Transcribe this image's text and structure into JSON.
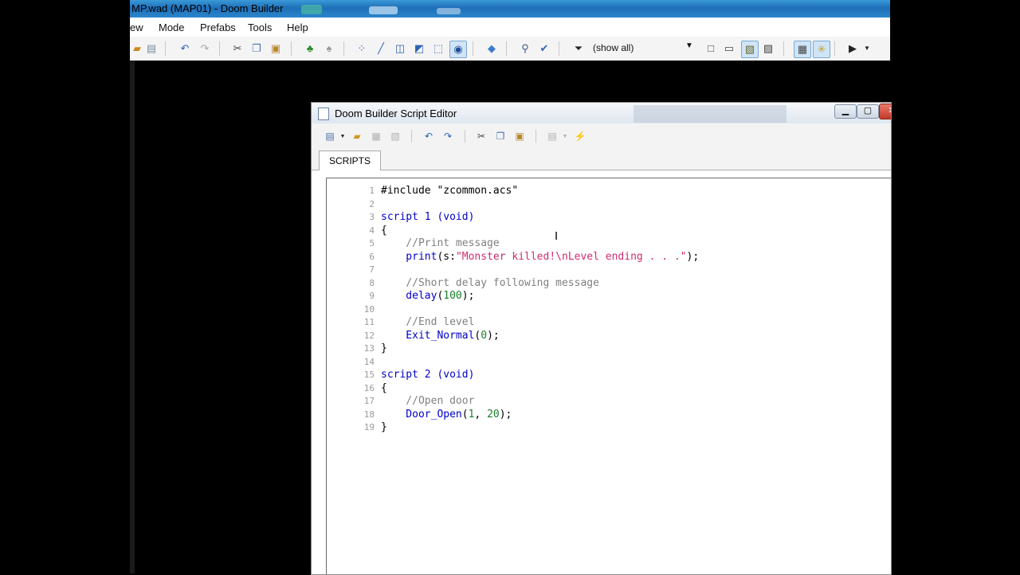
{
  "main_window": {
    "title": "MP.wad (MAP01) - Doom Builder",
    "menu": [
      "ew",
      "Mode",
      "Prefabs",
      "Tools",
      "Help"
    ],
    "filter": {
      "value": "(show all)"
    }
  },
  "script_editor": {
    "title": "Doom Builder Script Editor",
    "tabs": [
      {
        "label": "SCRIPTS"
      }
    ],
    "lines": [
      {
        "n": "1",
        "tokens": [
          {
            "t": "#include \"zcommon.acs\"",
            "c": "pl"
          }
        ]
      },
      {
        "n": "2",
        "tokens": []
      },
      {
        "n": "3",
        "tokens": [
          {
            "t": "script 1 (void)",
            "c": "kw"
          }
        ]
      },
      {
        "n": "4",
        "tokens": [
          {
            "t": "{",
            "c": "pl"
          }
        ]
      },
      {
        "n": "5",
        "tokens": [
          {
            "t": "    //Print message",
            "c": "cm"
          }
        ]
      },
      {
        "n": "6",
        "tokens": [
          {
            "t": "    print",
            "c": "kw"
          },
          {
            "t": "(s:",
            "c": "pl"
          },
          {
            "t": "\"Monster killed!\\nLevel ending . . .\"",
            "c": "st-lit"
          },
          {
            "t": ");",
            "c": "pl"
          }
        ]
      },
      {
        "n": "7",
        "tokens": []
      },
      {
        "n": "8",
        "tokens": [
          {
            "t": "    //Short delay following message",
            "c": "cm"
          }
        ]
      },
      {
        "n": "9",
        "tokens": [
          {
            "t": "    delay",
            "c": "kw"
          },
          {
            "t": "(",
            "c": "pl"
          },
          {
            "t": "100",
            "c": "num"
          },
          {
            "t": ");",
            "c": "pl"
          }
        ]
      },
      {
        "n": "10",
        "tokens": []
      },
      {
        "n": "11",
        "tokens": [
          {
            "t": "    //End level",
            "c": "cm"
          }
        ]
      },
      {
        "n": "12",
        "tokens": [
          {
            "t": "    Exit_Normal",
            "c": "kw"
          },
          {
            "t": "(",
            "c": "pl"
          },
          {
            "t": "0",
            "c": "num"
          },
          {
            "t": ");",
            "c": "pl"
          }
        ]
      },
      {
        "n": "13",
        "tokens": [
          {
            "t": "}",
            "c": "pl"
          }
        ]
      },
      {
        "n": "14",
        "tokens": []
      },
      {
        "n": "15",
        "tokens": [
          {
            "t": "script 2 (void)",
            "c": "kw"
          }
        ]
      },
      {
        "n": "16",
        "tokens": [
          {
            "t": "{",
            "c": "pl"
          }
        ]
      },
      {
        "n": "17",
        "tokens": [
          {
            "t": "    //Open door",
            "c": "cm"
          }
        ]
      },
      {
        "n": "18",
        "tokens": [
          {
            "t": "    Door_Open",
            "c": "kw"
          },
          {
            "t": "(",
            "c": "pl"
          },
          {
            "t": "1",
            "c": "num"
          },
          {
            "t": ", ",
            "c": "pl"
          },
          {
            "t": "20",
            "c": "num"
          },
          {
            "t": ");",
            "c": "pl"
          }
        ]
      },
      {
        "n": "19",
        "tokens": [
          {
            "t": "}",
            "c": "pl"
          }
        ]
      }
    ]
  }
}
